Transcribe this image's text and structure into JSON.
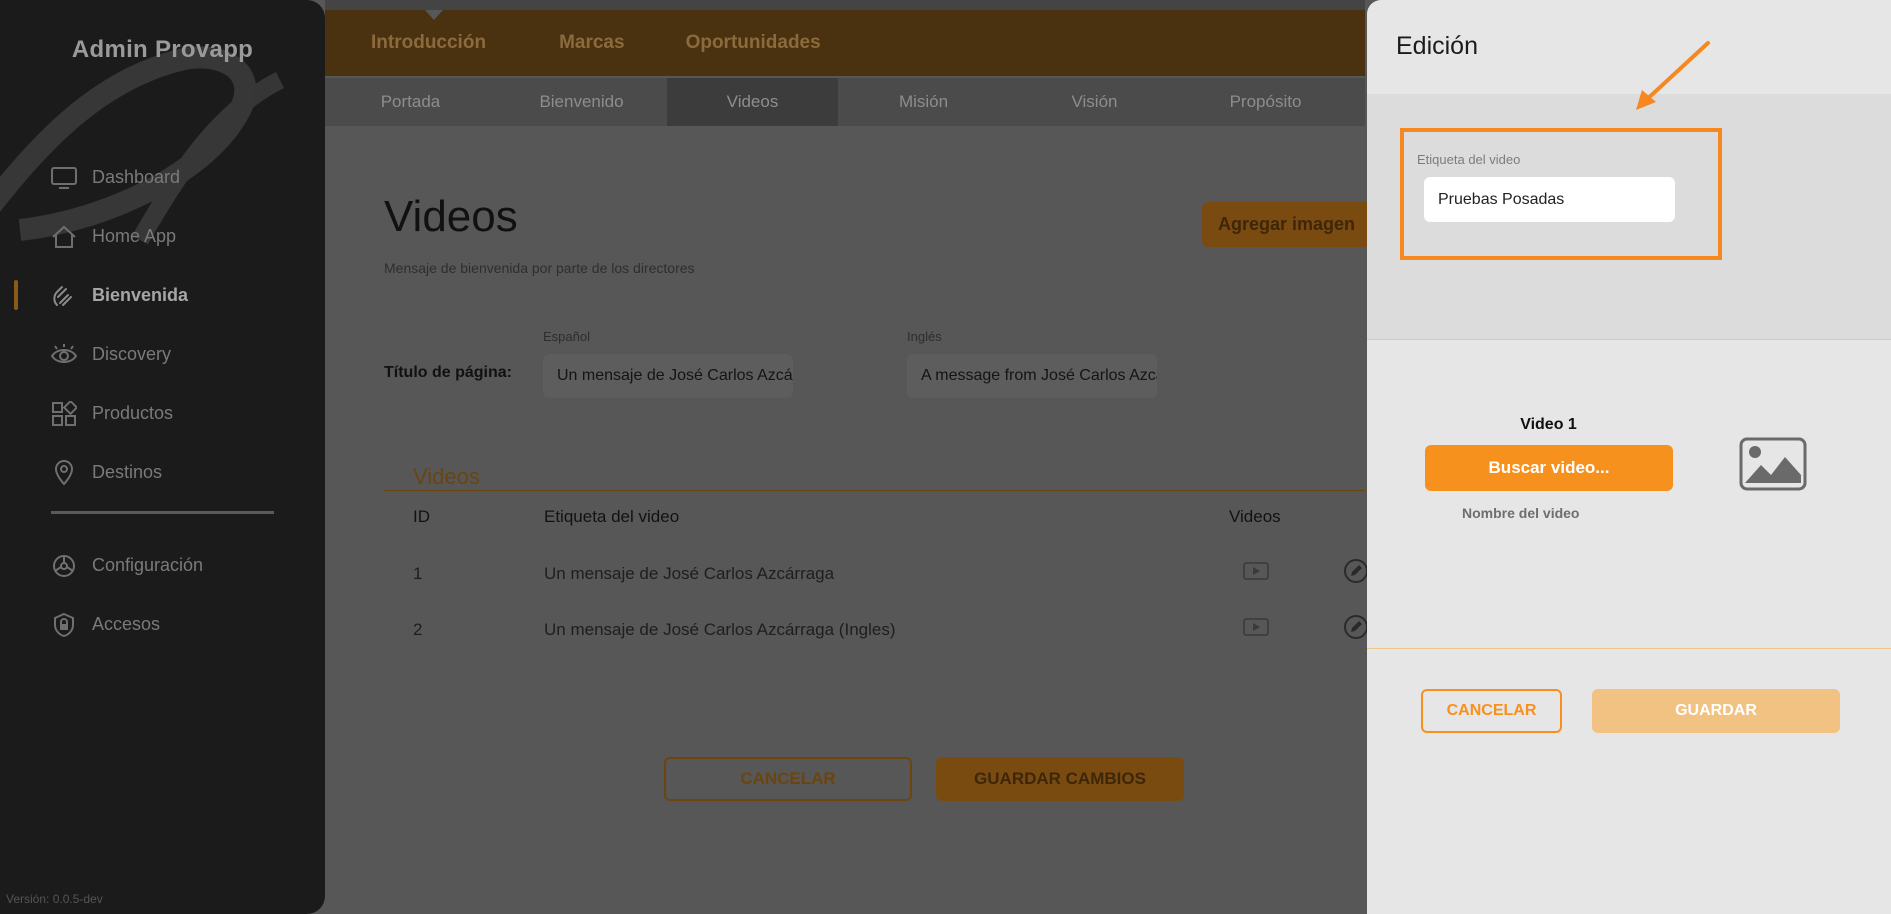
{
  "sidebar": {
    "brand": "Admin Provapp",
    "items": [
      {
        "label": "Dashboard",
        "icon": "monitor-icon"
      },
      {
        "label": "Home App",
        "icon": "home-icon"
      },
      {
        "label": "Bienvenida",
        "icon": "waving-hand-icon",
        "active": true
      },
      {
        "label": "Discovery",
        "icon": "eye-icon"
      },
      {
        "label": "Productos",
        "icon": "grid-shapes-icon"
      },
      {
        "label": "Destinos",
        "icon": "location-pin-icon"
      }
    ],
    "items2": [
      {
        "label": "Configuración",
        "icon": "settings-icon"
      },
      {
        "label": "Accesos",
        "icon": "shield-lock-icon"
      }
    ],
    "version": "Versión: 0.0.5-dev"
  },
  "topnav": {
    "tabs": [
      "Introducción",
      "Marcas",
      "Oportunidades"
    ],
    "subtabs": [
      "Portada",
      "Bienvenido",
      "Videos",
      "Misión",
      "Visión",
      "Propósito"
    ],
    "active_subtab": "Videos"
  },
  "main": {
    "title": "Videos",
    "subtitle": "Mensaje de bienvenida por parte de los directores",
    "add_button": "Agregar imagen",
    "page_title_label": "Título de página:",
    "lang_es": "Español",
    "lang_en": "Inglés",
    "title_es": "Un mensaje de José Carlos Azcárraga",
    "title_en": "A message from José Carlos Azcárraga",
    "section": "Videos",
    "table": {
      "headers": [
        "ID",
        "Etiqueta del video",
        "Videos"
      ],
      "rows": [
        {
          "id": "1",
          "label": "Un mensaje de José Carlos Azcárraga"
        },
        {
          "id": "2",
          "label": "Un mensaje de José Carlos Azcárraga (Ingles)"
        }
      ]
    },
    "cancel": "CANCELAR",
    "save": "GUARDAR CAMBIOS"
  },
  "panel": {
    "title": "Edición",
    "field_label": "Etiqueta del video",
    "field_value": "Pruebas Posadas",
    "video_label": "Video 1",
    "search_button": "Buscar video...",
    "video_name": "Nombre del video",
    "cancel": "CANCELAR",
    "save": "GUARDAR"
  },
  "colors": {
    "accent": "#f7911e",
    "highlight": "#f7871f",
    "sidebar": "#1b1b1b",
    "overlay": "#575757"
  }
}
